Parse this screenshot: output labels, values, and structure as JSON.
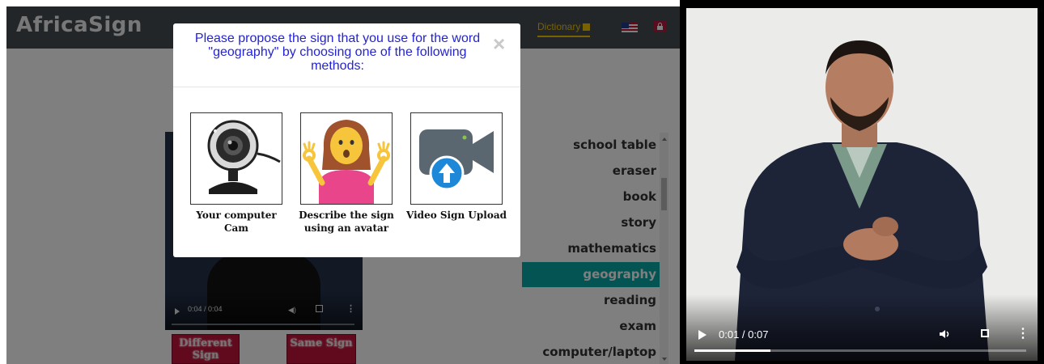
{
  "app": {
    "brand": "AfricaSign",
    "nav": {
      "dictionary_label": "Dictionary"
    }
  },
  "modal": {
    "title": "Please propose the sign that you use for the word \"geography\" by choosing one of the following methods:",
    "close_glyph": "×",
    "options": [
      {
        "label": "Your computer Cam",
        "icon": "webcam-icon"
      },
      {
        "label": "Describe the sign using an avatar",
        "icon": "avatar-icon"
      },
      {
        "label": "Video Sign Upload",
        "icon": "video-upload-icon"
      }
    ]
  },
  "small_video": {
    "time": "0:04 / 0:04"
  },
  "buttons": {
    "different_sign": "Different Sign",
    "same_sign": "Same Sign"
  },
  "word_list": {
    "items": [
      "school table",
      "eraser",
      "book",
      "story",
      "mathematics",
      "geography",
      "reading",
      "exam",
      "computer/laptop"
    ],
    "selected": "geography"
  },
  "right_video": {
    "time": "0:01 / 0:07",
    "progress": 0.23
  },
  "colors": {
    "navbar": "#454c53",
    "accent": "#f2c200",
    "selected_row": "#0aa8a8",
    "modal_title": "#2424d0",
    "red_button": "#c2143c"
  }
}
